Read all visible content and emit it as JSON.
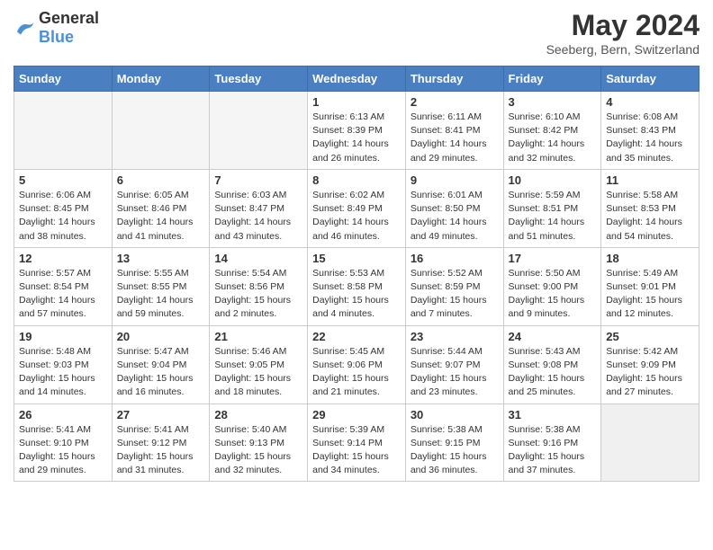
{
  "header": {
    "logo": {
      "general": "General",
      "blue": "Blue"
    },
    "title": "May 2024",
    "location": "Seeberg, Bern, Switzerland"
  },
  "weekdays": [
    "Sunday",
    "Monday",
    "Tuesday",
    "Wednesday",
    "Thursday",
    "Friday",
    "Saturday"
  ],
  "weeks": [
    [
      {
        "day": "",
        "empty": true
      },
      {
        "day": "",
        "empty": true
      },
      {
        "day": "",
        "empty": true
      },
      {
        "day": "1",
        "sunrise": "6:13 AM",
        "sunset": "8:39 PM",
        "daylight": "14 hours and 26 minutes."
      },
      {
        "day": "2",
        "sunrise": "6:11 AM",
        "sunset": "8:41 PM",
        "daylight": "14 hours and 29 minutes."
      },
      {
        "day": "3",
        "sunrise": "6:10 AM",
        "sunset": "8:42 PM",
        "daylight": "14 hours and 32 minutes."
      },
      {
        "day": "4",
        "sunrise": "6:08 AM",
        "sunset": "8:43 PM",
        "daylight": "14 hours and 35 minutes."
      }
    ],
    [
      {
        "day": "5",
        "sunrise": "6:06 AM",
        "sunset": "8:45 PM",
        "daylight": "14 hours and 38 minutes."
      },
      {
        "day": "6",
        "sunrise": "6:05 AM",
        "sunset": "8:46 PM",
        "daylight": "14 hours and 41 minutes."
      },
      {
        "day": "7",
        "sunrise": "6:03 AM",
        "sunset": "8:47 PM",
        "daylight": "14 hours and 43 minutes."
      },
      {
        "day": "8",
        "sunrise": "6:02 AM",
        "sunset": "8:49 PM",
        "daylight": "14 hours and 46 minutes."
      },
      {
        "day": "9",
        "sunrise": "6:01 AM",
        "sunset": "8:50 PM",
        "daylight": "14 hours and 49 minutes."
      },
      {
        "day": "10",
        "sunrise": "5:59 AM",
        "sunset": "8:51 PM",
        "daylight": "14 hours and 51 minutes."
      },
      {
        "day": "11",
        "sunrise": "5:58 AM",
        "sunset": "8:53 PM",
        "daylight": "14 hours and 54 minutes."
      }
    ],
    [
      {
        "day": "12",
        "sunrise": "5:57 AM",
        "sunset": "8:54 PM",
        "daylight": "14 hours and 57 minutes."
      },
      {
        "day": "13",
        "sunrise": "5:55 AM",
        "sunset": "8:55 PM",
        "daylight": "14 hours and 59 minutes."
      },
      {
        "day": "14",
        "sunrise": "5:54 AM",
        "sunset": "8:56 PM",
        "daylight": "15 hours and 2 minutes."
      },
      {
        "day": "15",
        "sunrise": "5:53 AM",
        "sunset": "8:58 PM",
        "daylight": "15 hours and 4 minutes."
      },
      {
        "day": "16",
        "sunrise": "5:52 AM",
        "sunset": "8:59 PM",
        "daylight": "15 hours and 7 minutes."
      },
      {
        "day": "17",
        "sunrise": "5:50 AM",
        "sunset": "9:00 PM",
        "daylight": "15 hours and 9 minutes."
      },
      {
        "day": "18",
        "sunrise": "5:49 AM",
        "sunset": "9:01 PM",
        "daylight": "15 hours and 12 minutes."
      }
    ],
    [
      {
        "day": "19",
        "sunrise": "5:48 AM",
        "sunset": "9:03 PM",
        "daylight": "15 hours and 14 minutes."
      },
      {
        "day": "20",
        "sunrise": "5:47 AM",
        "sunset": "9:04 PM",
        "daylight": "15 hours and 16 minutes."
      },
      {
        "day": "21",
        "sunrise": "5:46 AM",
        "sunset": "9:05 PM",
        "daylight": "15 hours and 18 minutes."
      },
      {
        "day": "22",
        "sunrise": "5:45 AM",
        "sunset": "9:06 PM",
        "daylight": "15 hours and 21 minutes."
      },
      {
        "day": "23",
        "sunrise": "5:44 AM",
        "sunset": "9:07 PM",
        "daylight": "15 hours and 23 minutes."
      },
      {
        "day": "24",
        "sunrise": "5:43 AM",
        "sunset": "9:08 PM",
        "daylight": "15 hours and 25 minutes."
      },
      {
        "day": "25",
        "sunrise": "5:42 AM",
        "sunset": "9:09 PM",
        "daylight": "15 hours and 27 minutes."
      }
    ],
    [
      {
        "day": "26",
        "sunrise": "5:41 AM",
        "sunset": "9:10 PM",
        "daylight": "15 hours and 29 minutes."
      },
      {
        "day": "27",
        "sunrise": "5:41 AM",
        "sunset": "9:12 PM",
        "daylight": "15 hours and 31 minutes."
      },
      {
        "day": "28",
        "sunrise": "5:40 AM",
        "sunset": "9:13 PM",
        "daylight": "15 hours and 32 minutes."
      },
      {
        "day": "29",
        "sunrise": "5:39 AM",
        "sunset": "9:14 PM",
        "daylight": "15 hours and 34 minutes."
      },
      {
        "day": "30",
        "sunrise": "5:38 AM",
        "sunset": "9:15 PM",
        "daylight": "15 hours and 36 minutes."
      },
      {
        "day": "31",
        "sunrise": "5:38 AM",
        "sunset": "9:16 PM",
        "daylight": "15 hours and 37 minutes."
      },
      {
        "day": "",
        "empty": true
      }
    ]
  ]
}
